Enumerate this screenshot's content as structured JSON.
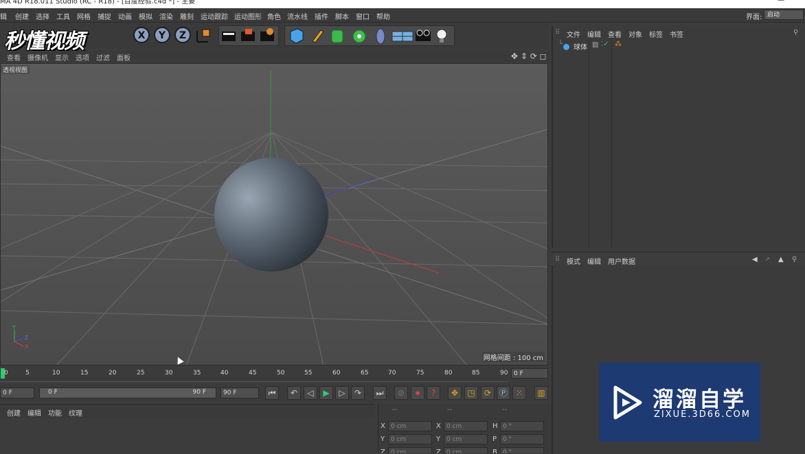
{
  "window": {
    "title": "MA 4D R18.011 Studio (RC - R18) - [百度经验.c4d *] - 主要",
    "minimize": "—"
  },
  "menubar": {
    "items": [
      "辑",
      "创建",
      "选择",
      "工具",
      "网格",
      "捕捉",
      "动画",
      "模拟",
      "渲染",
      "雕刻",
      "运动跟踪",
      "运动图形",
      "角色",
      "流水线",
      "插件",
      "脚本",
      "窗口",
      "帮助"
    ],
    "layout_label": "界面:",
    "layout_value": "启动"
  },
  "toolbar": {
    "axis_x": "X",
    "axis_y": "Y",
    "axis_z": "Z"
  },
  "watermark_top": {
    "text": "秒懂视频"
  },
  "viewport_menu": {
    "items": [
      "查看",
      "摄像机",
      "显示",
      "选项",
      "过滤",
      "面板"
    ]
  },
  "viewport": {
    "label": "透视视图",
    "grid_spacing": "网格间距 : 100 cm",
    "axis_labels": {
      "y": "Y",
      "z": "Z",
      "x": "X"
    }
  },
  "timeline": {
    "ticks": [
      "0",
      "5",
      "10",
      "15",
      "20",
      "25",
      "30",
      "35",
      "40",
      "45",
      "50",
      "55",
      "60",
      "65",
      "70",
      "75",
      "80",
      "85",
      "90"
    ],
    "current_frame": "0 F"
  },
  "playback": {
    "start": "0 F",
    "range_start": "0 F",
    "range_end": "90 F",
    "end": "90 F"
  },
  "material_menu": {
    "items": [
      "创建",
      "编辑",
      "功能",
      "纹理"
    ]
  },
  "coordinates": {
    "headers": [
      "--",
      "--",
      "--"
    ],
    "rows": [
      {
        "l1": "X",
        "v1": "0 cm",
        "l2": "X",
        "v2": "0 cm",
        "l3": "H",
        "v3": "0 °"
      },
      {
        "l1": "Y",
        "v1": "0 cm",
        "l2": "Y",
        "v2": "0 cm",
        "l3": "P",
        "v3": "0 °"
      },
      {
        "l1": "Z",
        "v1": "0 cm",
        "l2": "Z",
        "v2": "0 cm",
        "l3": "B",
        "v3": "0 °"
      }
    ]
  },
  "object_manager": {
    "menu": [
      "文件",
      "编辑",
      "查看",
      "对象",
      "标签",
      "书签"
    ],
    "objects": [
      {
        "name": "球体"
      }
    ]
  },
  "attribute_manager": {
    "menu": [
      "模式",
      "编辑",
      "用户数据"
    ]
  },
  "watermark": {
    "title": "溜溜自学",
    "url": "ZIXUE.3D66.COM"
  },
  "colors": {
    "watermark_bg": "#1d3a72",
    "accent_green": "#2ecc71",
    "sphere": "#5a6572"
  }
}
